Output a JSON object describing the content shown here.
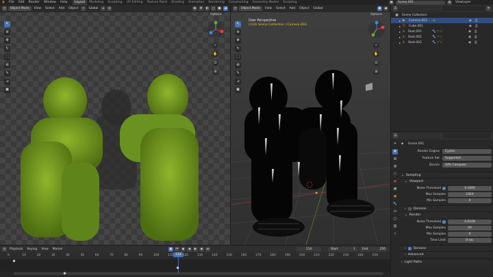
{
  "menu": {
    "file": "File",
    "edit": "Edit",
    "render": "Render",
    "window": "Window",
    "help": "Help"
  },
  "workspaces": [
    "Layout",
    "Modeling",
    "Sculpting",
    "UV Editing",
    "Texture Paint",
    "Shading",
    "Animation",
    "Rendering",
    "Compositing",
    "Geometry Nodes",
    "Scripting"
  ],
  "top_right": {
    "scene": "Scene.001",
    "view_layer": "ViewLayer"
  },
  "left_view": {
    "mode": "Object Mode",
    "view": "View",
    "select": "Select",
    "add": "Add",
    "object": "Object",
    "transform": "Global",
    "options": "Options"
  },
  "right_view": {
    "mode": "Object Mode",
    "view": "View",
    "select": "Select",
    "add": "Add",
    "object": "Object",
    "transform": "Global",
    "options": "Options",
    "title": "User Perspective",
    "subtitle": "(114) Scene Collection | Camera.003"
  },
  "outliner": {
    "header": "Scene Collection",
    "items": [
      {
        "name": "Camera.003",
        "icon": "camera-icon",
        "selected": true
      },
      {
        "name": "Cube.001",
        "icon": "cube-icon",
        "selected": false
      },
      {
        "name": "Root.001",
        "icon": "armature-icon",
        "selected": false
      },
      {
        "name": "Root.002",
        "icon": "armature-icon",
        "selected": false
      },
      {
        "name": "Root.003",
        "icon": "armature-icon",
        "selected": false
      }
    ]
  },
  "properties": {
    "scene_name": "Scene.001",
    "render_engine_label": "Render Engine",
    "render_engine": "Cycles",
    "feature_set_label": "Feature Set",
    "feature_set": "Supported",
    "device_label": "Device",
    "device": "GPU Compute",
    "sampling": "Sampling",
    "viewport": "Viewport",
    "vp_noise_label": "Noise Threshold",
    "vp_noise": "0.1000",
    "vp_max_label": "Max Samples",
    "vp_max": "1024",
    "vp_min_label": "Min Samples",
    "vp_min": "0",
    "denoise": "Denoise",
    "render": "Render",
    "r_noise_label": "Noise Threshold",
    "r_noise": "0.0100",
    "r_max_label": "Max Samples",
    "r_max": "20",
    "r_min_label": "Min Samples",
    "r_min": "0",
    "r_time_label": "Time Limit",
    "r_time": "0 sec",
    "r_denoise": "Denoise",
    "advanced": "Advanced",
    "light_paths": "Light Paths"
  },
  "timeline": {
    "playback": "Playback",
    "keying": "Keying",
    "view": "View",
    "marker": "Marker",
    "current_frame": "114",
    "start_label": "Start",
    "start": "1",
    "end_label": "End",
    "end": "250",
    "ticks": [
      "0",
      "10",
      "20",
      "30",
      "40",
      "50",
      "60",
      "70",
      "80",
      "90",
      "100",
      "110",
      "120",
      "130",
      "140",
      "150",
      "160",
      "170",
      "180",
      "190",
      "200",
      "210",
      "220",
      "230",
      "240",
      "250"
    ],
    "playhead": "114"
  },
  "colors": {
    "accent": "#4772b3",
    "selection": "#f0a030",
    "fur": "#6f9a1f"
  }
}
